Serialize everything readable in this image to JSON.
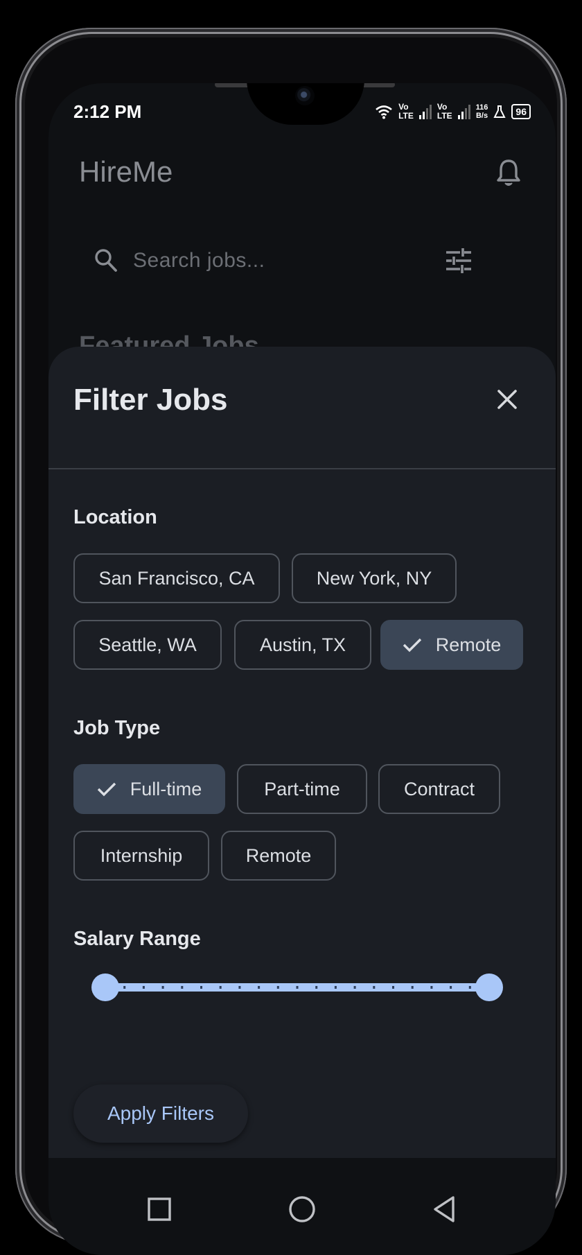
{
  "status_bar": {
    "time": "2:12 PM",
    "lte1_top": "Vo",
    "lte1_bottom": "LTE",
    "lte2_top": "Vo",
    "lte2_bottom": "LTE",
    "speed_value": "116",
    "speed_unit": "B/s",
    "battery": "96"
  },
  "app": {
    "title": "HireMe",
    "search_placeholder": "Search jobs...",
    "featured_heading": "Featured Jobs"
  },
  "filter_sheet": {
    "title": "Filter Jobs",
    "location": {
      "label": "Location",
      "chips": [
        {
          "label": "San Francisco, CA",
          "selected": false
        },
        {
          "label": "New York, NY",
          "selected": false
        },
        {
          "label": "Seattle, WA",
          "selected": false
        },
        {
          "label": "Austin, TX",
          "selected": false
        },
        {
          "label": "Remote",
          "selected": true
        }
      ]
    },
    "job_type": {
      "label": "Job Type",
      "chips": [
        {
          "label": "Full-time",
          "selected": true
        },
        {
          "label": "Part-time",
          "selected": false
        },
        {
          "label": "Contract",
          "selected": false
        },
        {
          "label": "Internship",
          "selected": false
        },
        {
          "label": "Remote",
          "selected": false
        }
      ]
    },
    "salary": {
      "label": "Salary Range",
      "range_start": 0.0,
      "range_end": 1.0,
      "divisions": 20
    },
    "apply_label": "Apply Filters"
  },
  "colors": {
    "accent": "#a9c7f8",
    "sheet_bg": "#1b1e24",
    "chip_selected_bg": "#3b4656"
  },
  "icons": {
    "bell": "bell-icon",
    "search": "search-icon",
    "tune": "tune-icon",
    "close": "close-icon",
    "check": "check-icon",
    "nav_recents": "square-icon",
    "nav_home": "circle-icon",
    "nav_back": "triangle-back-icon"
  }
}
